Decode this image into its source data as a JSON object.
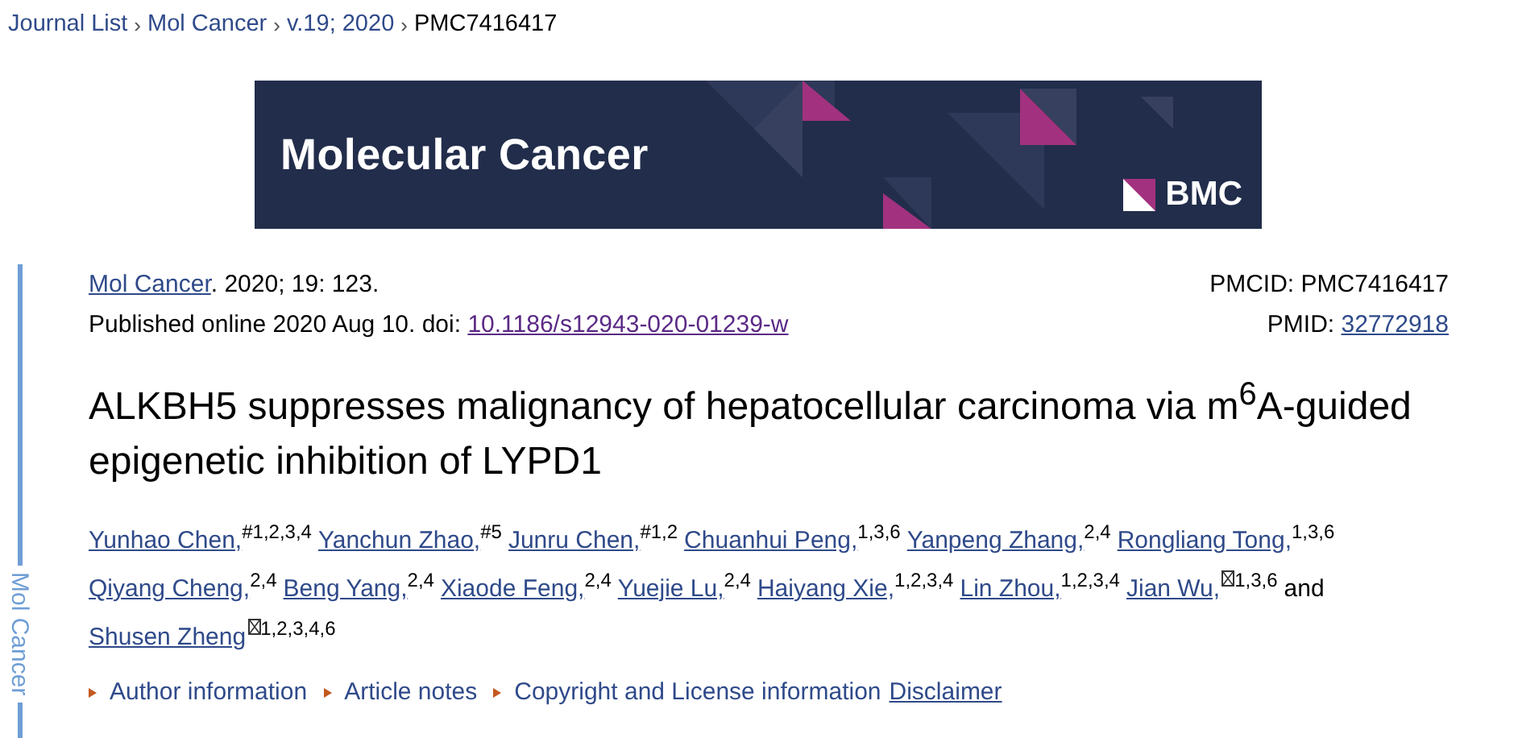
{
  "breadcrumbs": [
    {
      "label": "Journal List",
      "link": true
    },
    {
      "label": "Mol Cancer",
      "link": true
    },
    {
      "label": "v.19; 2020",
      "link": true
    },
    {
      "label": "PMC7416417",
      "link": false
    }
  ],
  "breadcrumb_separator": "›",
  "banner": {
    "journal": "Molecular Cancer",
    "publisher": "BMC"
  },
  "sidebar": {
    "label": "Mol Cancer"
  },
  "citation": {
    "journal": "Mol Cancer",
    "details": ". 2020; 19: 123.",
    "published": "Published online 2020 Aug 10. doi: ",
    "doi": "10.1186/s12943-020-01239-w",
    "pmcid": "PMCID: PMC7416417",
    "pmid_label": "PMID: ",
    "pmid": "32772918"
  },
  "title": "ALKBH5 suppresses malignancy of hepatocellular carcinoma via m$^{6}$A-guided epigenetic inhibition of LYPD1",
  "authors": [
    {
      "kind": "author",
      "name": "Yunhao Chen,",
      "sup": "#1,2,3,4",
      "corresponding": false
    },
    {
      "kind": "author",
      "name": "Yanchun Zhao,",
      "sup": "#5",
      "corresponding": false
    },
    {
      "kind": "author",
      "name": "Junru Chen,",
      "sup": "#1,2",
      "corresponding": false
    },
    {
      "kind": "author",
      "name": "Chuanhui Peng,",
      "sup": "1,3,6",
      "corresponding": false
    },
    {
      "kind": "author",
      "name": "Yanpeng Zhang,",
      "sup": "2,4",
      "corresponding": false
    },
    {
      "kind": "author",
      "name": "Rongliang Tong,",
      "sup": "1,3,6",
      "corresponding": false
    },
    {
      "kind": "author",
      "name": "Qiyang Cheng,",
      "sup": "2,4",
      "corresponding": false
    },
    {
      "kind": "author",
      "name": "Beng Yang,",
      "sup": "2,4",
      "corresponding": false
    },
    {
      "kind": "author",
      "name": "Xiaode Feng,",
      "sup": "2,4",
      "corresponding": false
    },
    {
      "kind": "author",
      "name": "Yuejie Lu,",
      "sup": "2,4",
      "corresponding": false
    },
    {
      "kind": "author",
      "name": "Haiyang Xie,",
      "sup": "1,2,3,4",
      "corresponding": false
    },
    {
      "kind": "author",
      "name": "Lin Zhou,",
      "sup": "1,2,3,4",
      "corresponding": false
    },
    {
      "kind": "author",
      "name": "Jian Wu,",
      "sup": "1,3,6",
      "corresponding": true
    },
    {
      "kind": "conjunction",
      "name": "and"
    },
    {
      "kind": "author",
      "name": "Shusen Zheng",
      "sup": "1,2,3,4,6",
      "corresponding": true
    }
  ],
  "info_links": [
    {
      "label": "Author information",
      "expandable": true
    },
    {
      "label": "Article notes",
      "expandable": true
    },
    {
      "label": "Copyright and License information",
      "expandable": true
    },
    {
      "label": "Disclaimer",
      "expandable": false
    }
  ]
}
